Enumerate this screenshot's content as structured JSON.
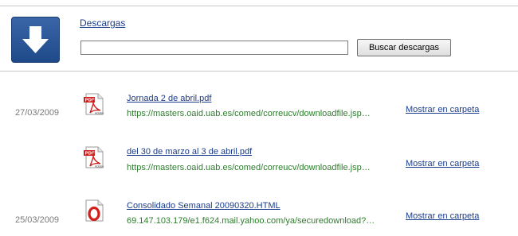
{
  "header": {
    "title": "Descargas",
    "search_placeholder": "",
    "search_value": "",
    "search_button": "Buscar descargas"
  },
  "downloads": [
    {
      "date": "27/03/2009",
      "name": "Jornada 2 de abril.pdf",
      "url": "https://masters.oaid.uab.es/comed/correucv/downloadfile.jsp…",
      "action": "Mostrar en carpeta",
      "icon": "pdf-file-icon"
    },
    {
      "date": "",
      "name": "del 30 de marzo al 3 de abril.pdf",
      "url": "https://masters.oaid.uab.es/comed/correucv/downloadfile.jsp…",
      "action": "Mostrar en carpeta",
      "icon": "pdf-file-icon"
    },
    {
      "date": "25/03/2009",
      "name": "Consolidado Semanal 20090320.HTML",
      "url": "69.147.103.179/e1.f624.mail.yahoo.com/ya/securedownload?…",
      "action": "Mostrar en carpeta",
      "icon": "opera-html-file-icon"
    }
  ],
  "colors": {
    "link": "#1a3c8c",
    "url": "#2e7d2e",
    "date": "#7a7a7a",
    "logo": "#2a5596"
  }
}
